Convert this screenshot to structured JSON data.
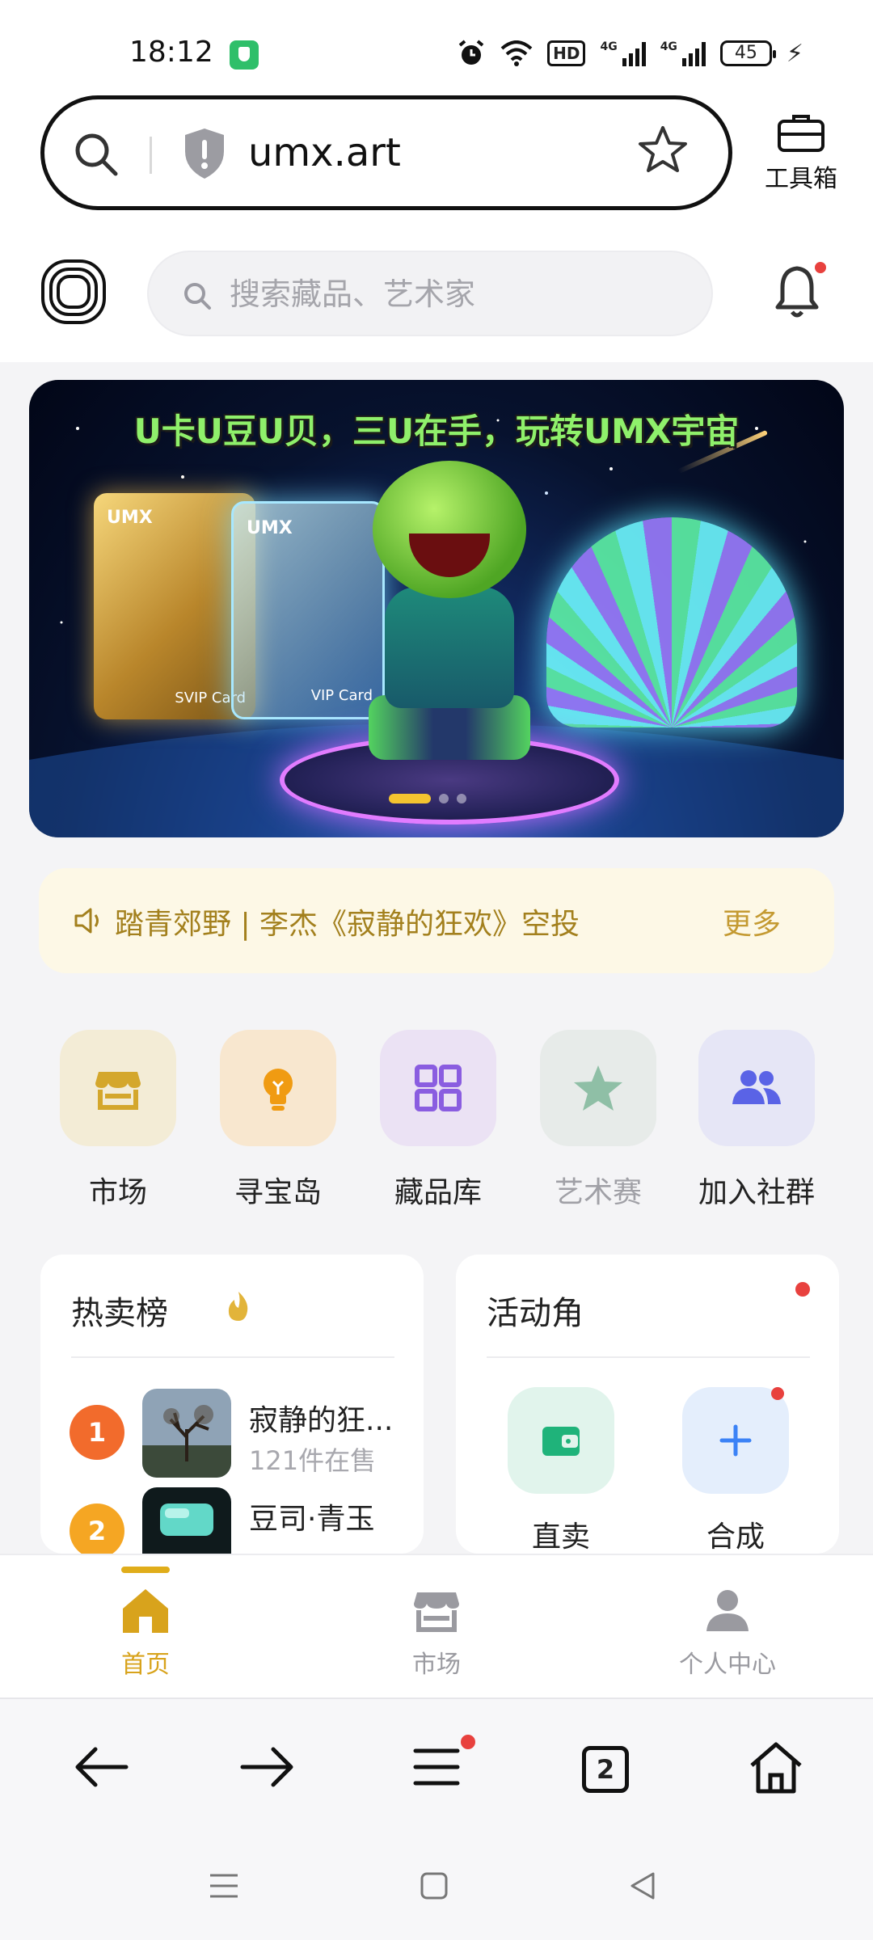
{
  "status_bar": {
    "time": "18:12",
    "hd_label": "HD",
    "network_1": "4G",
    "network_2": "4G",
    "battery": "45"
  },
  "browser": {
    "url": "umx.art",
    "toolbox_label": "工具箱"
  },
  "app_header": {
    "search_placeholder": "搜索藏品、艺术家"
  },
  "banner": {
    "title": "U卡U豆U贝，三U在手，玩转UMX宇宙",
    "card1_brand": "UMX",
    "card1_sub": "SVIP Card",
    "card2_brand": "UMX",
    "card2_sub": "VIP Card",
    "active_slide": 1,
    "slide_count": 3
  },
  "notice": {
    "text": "踏青郊野 | 李杰《寂静的狂欢》空投",
    "more_label": "更多"
  },
  "quick_links": [
    {
      "label": "市场",
      "icon": "store-icon",
      "color": "#d4a72c",
      "bg": "#f3ecd6"
    },
    {
      "label": "寻宝岛",
      "icon": "bulb-icon",
      "color": "#f09b12",
      "bg": "#f8e7cf"
    },
    {
      "label": "藏品库",
      "icon": "grid-icon",
      "color": "#8a5de0",
      "bg": "#ebe2f4"
    },
    {
      "label": "艺术赛",
      "icon": "star-icon",
      "color": "#8fbfa6",
      "bg": "#e7ebe9"
    },
    {
      "label": "加入社群",
      "icon": "group-icon",
      "color": "#5a63e6",
      "bg": "#e6e6f6"
    }
  ],
  "hot_list": {
    "title": "热卖榜",
    "items": [
      {
        "rank": "1",
        "name": "寂静的狂...",
        "sub": "121件在售",
        "badge_color": "#f26b2c"
      },
      {
        "rank": "2",
        "name": "豆司·青玉",
        "sub": "",
        "badge_color": "#f5a623"
      }
    ]
  },
  "activity": {
    "title": "活动角",
    "items": [
      {
        "label": "直卖",
        "icon": "wallet-icon",
        "color": "#1fb37a",
        "bg": "#e1f4ec"
      },
      {
        "label": "合成",
        "icon": "plus-icon",
        "color": "#3b82f6",
        "bg": "#e4eefc"
      }
    ]
  },
  "tab_bar": {
    "items": [
      {
        "label": "首页",
        "active": true
      },
      {
        "label": "市场",
        "active": false
      },
      {
        "label": "个人中心",
        "active": false
      }
    ]
  },
  "browser_nav": {
    "tab_count": "2"
  },
  "colors": {
    "accent": "#d8a31c",
    "notice_bg": "#fdf8e6",
    "badge_red": "#e8413e"
  }
}
